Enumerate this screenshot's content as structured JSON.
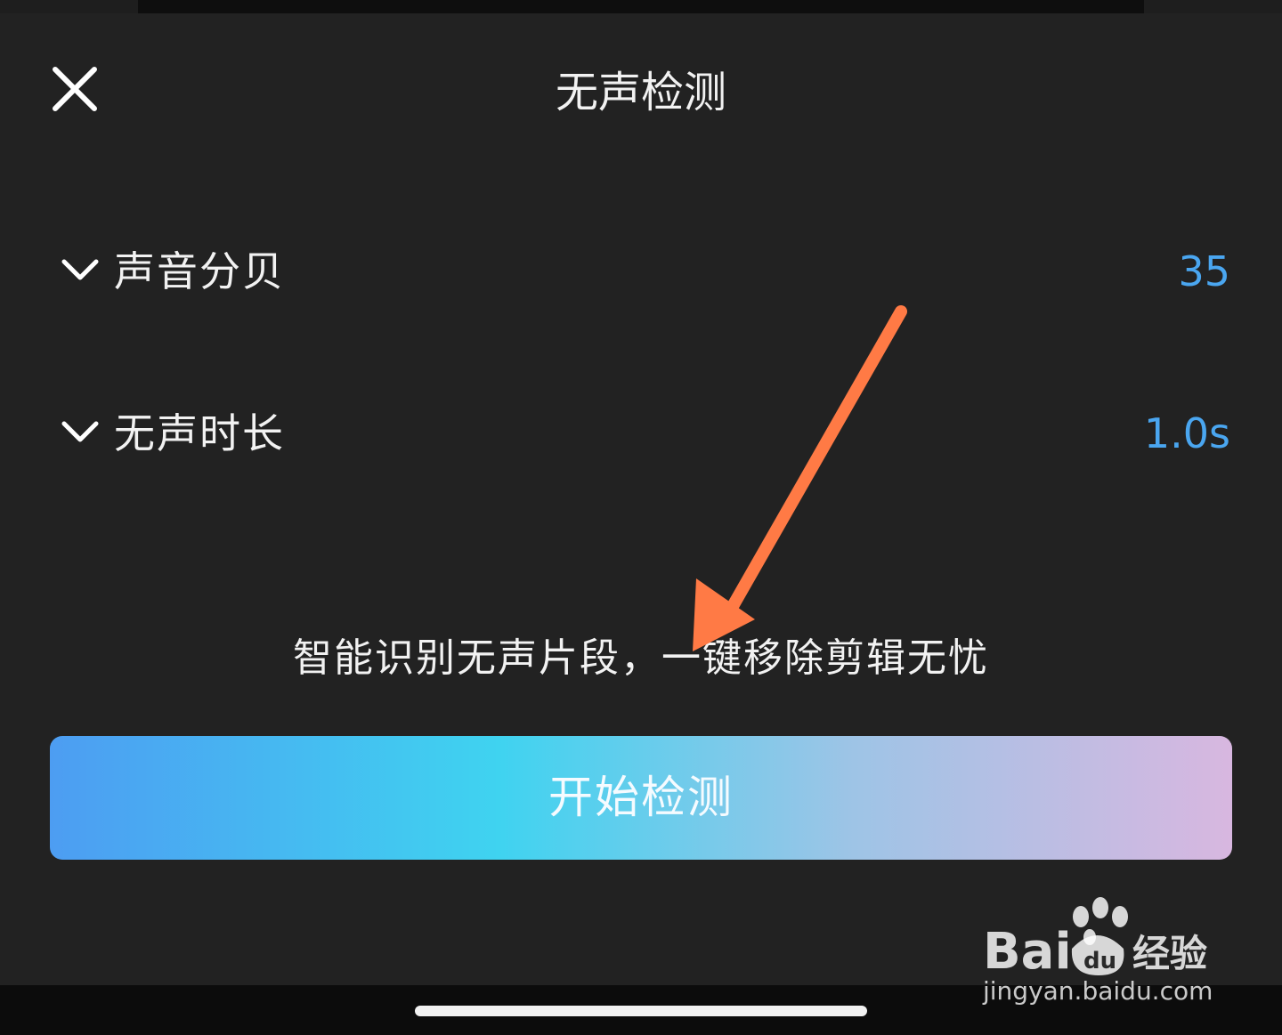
{
  "header": {
    "title": "无声检测",
    "close_icon": "close-icon"
  },
  "settings": [
    {
      "label": "声音分贝",
      "value": "35",
      "icon": "chevron-down-icon"
    },
    {
      "label": "无声时长",
      "value": "1.0s",
      "icon": "chevron-down-icon"
    }
  ],
  "hint": "智能识别无声片段，一键移除剪辑无忧",
  "start_button": {
    "label": "开始检测"
  },
  "watermark": {
    "brand": "Bai du 经验",
    "url": "jingyan.baidu.com"
  },
  "colors": {
    "background": "#222222",
    "value_accent": "#4aa6f0",
    "arrow": "#ff7a45",
    "button_gradient": [
      "#4d9df2",
      "#3fd3f0",
      "#9ec4e6",
      "#d8b7e0"
    ]
  }
}
